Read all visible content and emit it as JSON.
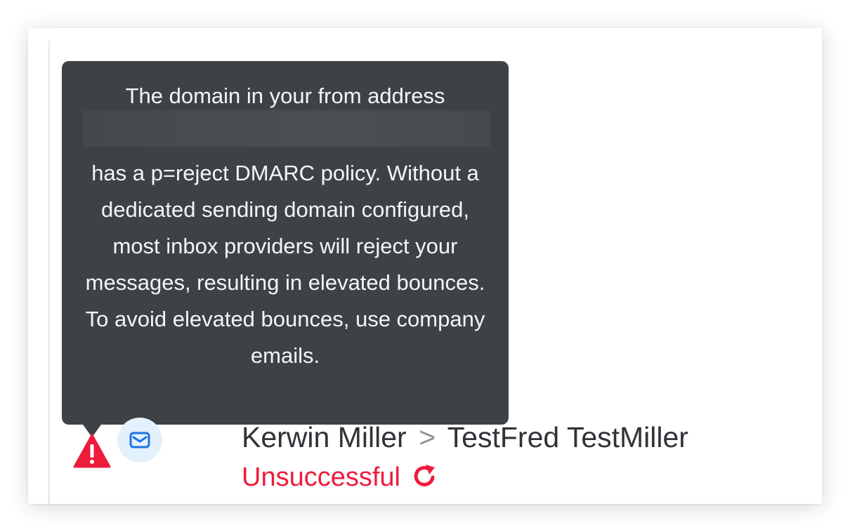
{
  "tooltip": {
    "line1": "The domain in your from address",
    "body": "has a p=reject DMARC policy. Without a dedicated sending domain configured, most inbox providers will reject your messages, resulting in elevated bounces. To avoid elevated bounces, use company emails."
  },
  "activity": {
    "sender": "Kerwin Miller",
    "separator": ">",
    "recipient": "TestFred TestMiller",
    "status": "Unsuccessful"
  },
  "icons": {
    "warning": "warning-triangle-icon",
    "channel": "mail-icon",
    "retry": "retry-icon"
  },
  "colors": {
    "tooltip_bg": "#3e4245",
    "error": "#ee1c3b",
    "mail_accent": "#1a73e8",
    "mail_bg": "#e3f1fd"
  }
}
